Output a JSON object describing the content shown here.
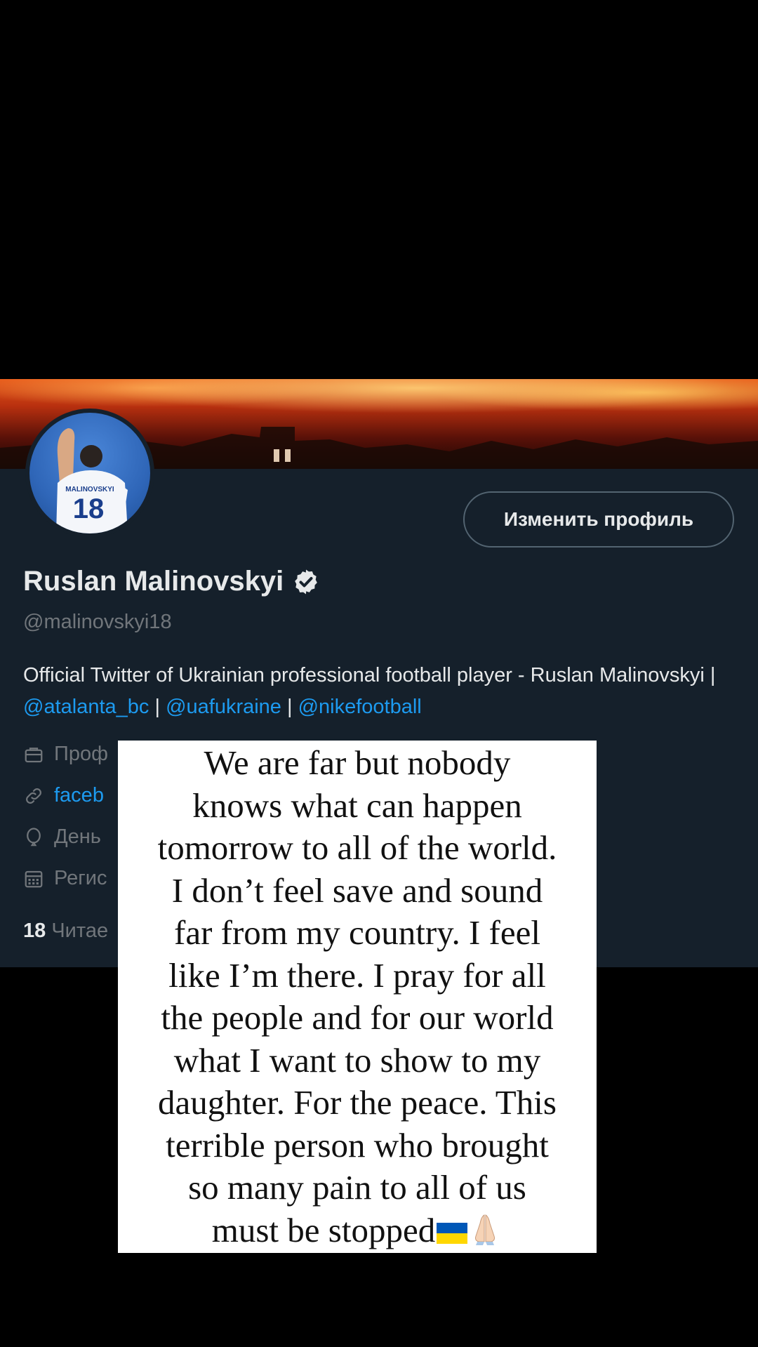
{
  "profile": {
    "edit_button": "Изменить профиль",
    "name": "Ruslan Malinovskyi",
    "handle": "@malinovskyi18",
    "bio_text": "Official Twitter of Ukrainian professional football player - Ruslan Malinovskyi | ",
    "bio_links": [
      "@atalanta_bc",
      "@uafukraine",
      "@nikefootball"
    ],
    "bio_separator": " | ",
    "meta": [
      {
        "icon": "briefcase-icon",
        "text": "Проф"
      },
      {
        "icon": "link-icon",
        "text": "faceb"
      },
      {
        "icon": "balloon-icon",
        "text": "День"
      },
      {
        "icon": "calendar-icon",
        "text": "Регис"
      }
    ],
    "following_count": "18",
    "following_label": "Читае",
    "avatar_jersey_name": "MALINOVSKYI",
    "avatar_jersey_number": "18"
  },
  "story": {
    "lines": [
      "We are far but nobody",
      "knows what can happen",
      "tomorrow to all of the world.",
      "I don’t feel save and sound",
      "far from my country. I feel",
      "like I’m there. I pray for all",
      "the people and for our world",
      "what I want to show to my",
      "daughter. For the peace. This",
      "terrible person who brought",
      "so many pain to all of us",
      "must be stopped"
    ],
    "end_emojis": [
      "flag-ukraine-icon",
      "folded-hands-icon"
    ]
  },
  "colors": {
    "profile_bg": "#15202b",
    "text_primary": "#e7e9ea",
    "text_secondary": "#71767b",
    "link": "#1d9bf0",
    "flag_blue": "#0057b7",
    "flag_yellow": "#ffd700"
  }
}
